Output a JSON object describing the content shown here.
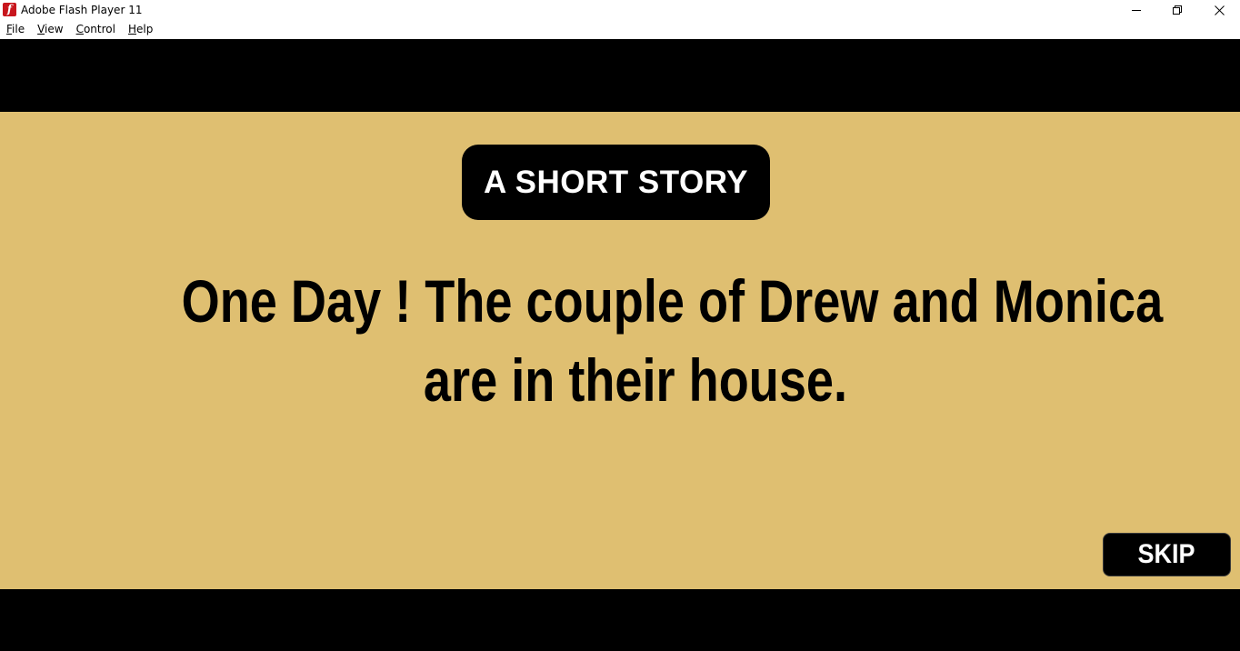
{
  "window": {
    "title": "Adobe Flash Player 11",
    "app_icon_glyph": "f",
    "controls": [
      "minimize-icon",
      "restore-icon",
      "close-icon"
    ]
  },
  "menu": {
    "items": [
      {
        "accel": "F",
        "rest": "ile"
      },
      {
        "accel": "V",
        "rest": "iew"
      },
      {
        "accel": "C",
        "rest": "ontrol"
      },
      {
        "accel": "H",
        "rest": "elp"
      }
    ]
  },
  "scene": {
    "badge": "A SHORT STORY",
    "line1": "One Day ! The couple of Drew and Monica",
    "line2": "are in their house.",
    "skip": "SKIP"
  },
  "colors": {
    "scene_background": "#dfbf71",
    "letterbox": "#000000",
    "flash_icon_red": "#c8161d"
  }
}
